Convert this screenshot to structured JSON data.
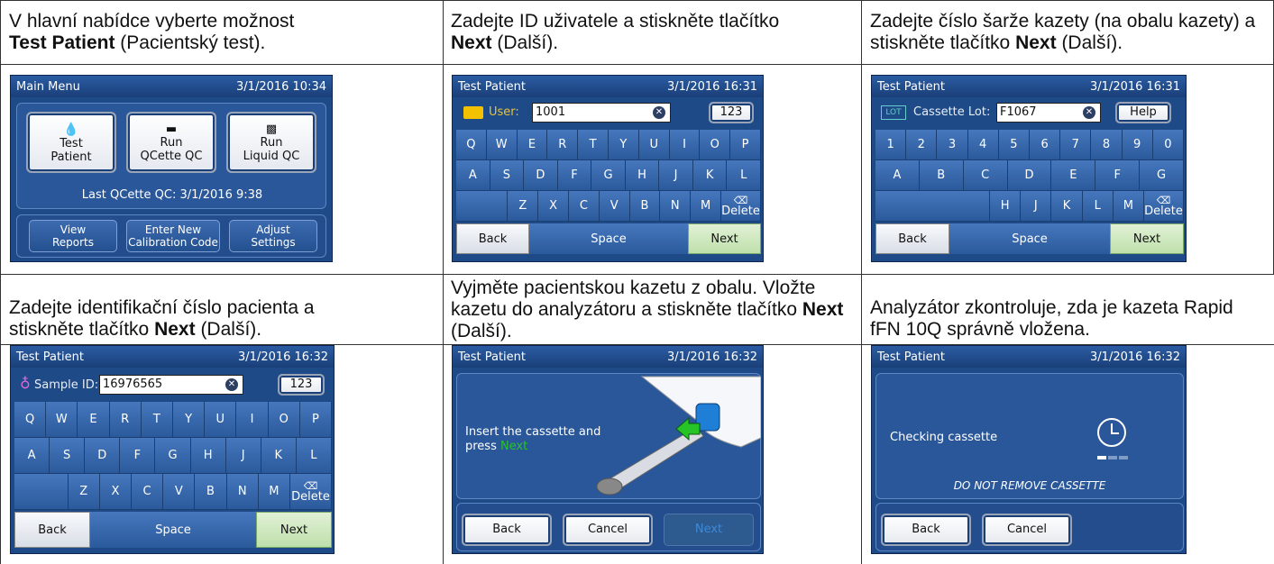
{
  "instructions": {
    "step1": {
      "pre": "V hlavní nabídce vyberte možnost",
      "bold": "Test Patient",
      "post": " (Pacientský test)."
    },
    "step2": {
      "pre": "Zadejte ID uživatele a stiskněte tlačítko",
      "bold": "Next",
      "post": " (Další)."
    },
    "step3": {
      "pre": "Zadejte číslo šarže kazety (na obalu kazety) a stiskněte tlačítko ",
      "bold": "Next",
      "post": " (Další)."
    },
    "step4": {
      "pre": "Zadejte identifikační číslo pacienta a stiskněte tlačítko ",
      "bold": "Next",
      "post": " (Další)."
    },
    "step5": {
      "pre": "Vyjměte pacientskou kazetu z obalu. Vložte kazetu do analyzátoru a stiskněte tlačítko ",
      "bold": "Next",
      "post": " (Další)."
    },
    "step6": {
      "text": "Analyzátor zkontroluje, zda je kazeta Rapid fFN 10Q správně vložena."
    }
  },
  "main_menu": {
    "title": "Main Menu",
    "datetime": "3/1/2016 10:34",
    "buttons": [
      {
        "line1": "Test",
        "line2": "Patient",
        "icon": "test-tube-icon"
      },
      {
        "line1": "Run",
        "line2": "QCette QC",
        "icon": "qcette-icon"
      },
      {
        "line1": "Run",
        "line2": "Liquid QC",
        "icon": "liquid-qc-icon"
      }
    ],
    "last_qc": "Last QCette QC: 3/1/2016 9:38",
    "bottom_buttons": [
      {
        "line1": "View",
        "line2": "Reports"
      },
      {
        "line1": "Enter New",
        "line2": "Calibration Code"
      },
      {
        "line1": "Adjust",
        "line2": "Settings"
      }
    ]
  },
  "user_screen": {
    "title": "Test Patient",
    "datetime": "3/1/2016 16:31",
    "field_label": "User:",
    "field_value": "1001",
    "mode_button": "123",
    "row1": [
      "Q",
      "W",
      "E",
      "R",
      "T",
      "Y",
      "U",
      "I",
      "O",
      "P"
    ],
    "row2": [
      "A",
      "S",
      "D",
      "F",
      "G",
      "H",
      "J",
      "K",
      "L"
    ],
    "row3": [
      "Z",
      "X",
      "C",
      "V",
      "B",
      "N",
      "M"
    ],
    "delete": "Delete",
    "back": "Back",
    "space": "Space",
    "next": "Next"
  },
  "lot_screen": {
    "title": "Test Patient",
    "datetime": "3/1/2016 16:31",
    "badge": "LOT",
    "field_label": "Cassette Lot:",
    "field_value": "F1067",
    "help_button": "Help",
    "row1": [
      "1",
      "2",
      "3",
      "4",
      "5",
      "6",
      "7",
      "8",
      "9",
      "0"
    ],
    "row2": [
      "A",
      "B",
      "C",
      "D",
      "E",
      "F",
      "G"
    ],
    "row3": [
      "H",
      "J",
      "K",
      "L",
      "M"
    ],
    "delete": "Delete",
    "back": "Back",
    "space": "Space",
    "next": "Next"
  },
  "sample_screen": {
    "title": "Test Patient",
    "datetime": "3/1/2016 16:32",
    "field_label": "Sample ID:",
    "field_value": "16976565",
    "mode_button": "123",
    "row1": [
      "Q",
      "W",
      "E",
      "R",
      "T",
      "Y",
      "U",
      "I",
      "O",
      "P"
    ],
    "row2": [
      "A",
      "S",
      "D",
      "F",
      "G",
      "H",
      "J",
      "K",
      "L"
    ],
    "row3": [
      "Z",
      "X",
      "C",
      "V",
      "B",
      "N",
      "M"
    ],
    "delete": "Delete",
    "back": "Back",
    "space": "Space",
    "next": "Next"
  },
  "insert_screen": {
    "title": "Test Patient",
    "datetime": "3/1/2016 16:32",
    "message_line1": "Insert the cassette and",
    "message_press": "press ",
    "message_next": "Next",
    "back": "Back",
    "cancel": "Cancel",
    "next": "Next"
  },
  "checking_screen": {
    "title": "Test Patient",
    "datetime": "3/1/2016 16:32",
    "message": "Checking cassette",
    "warning": "DO NOT REMOVE CASSETTE",
    "progress": 0.33,
    "back": "Back",
    "cancel": "Cancel"
  },
  "colors": {
    "screen_bg": "#1e4a88",
    "key_blue": "#3a69ad",
    "next_green": "#cfe8c2",
    "accent_green": "#27c427"
  }
}
